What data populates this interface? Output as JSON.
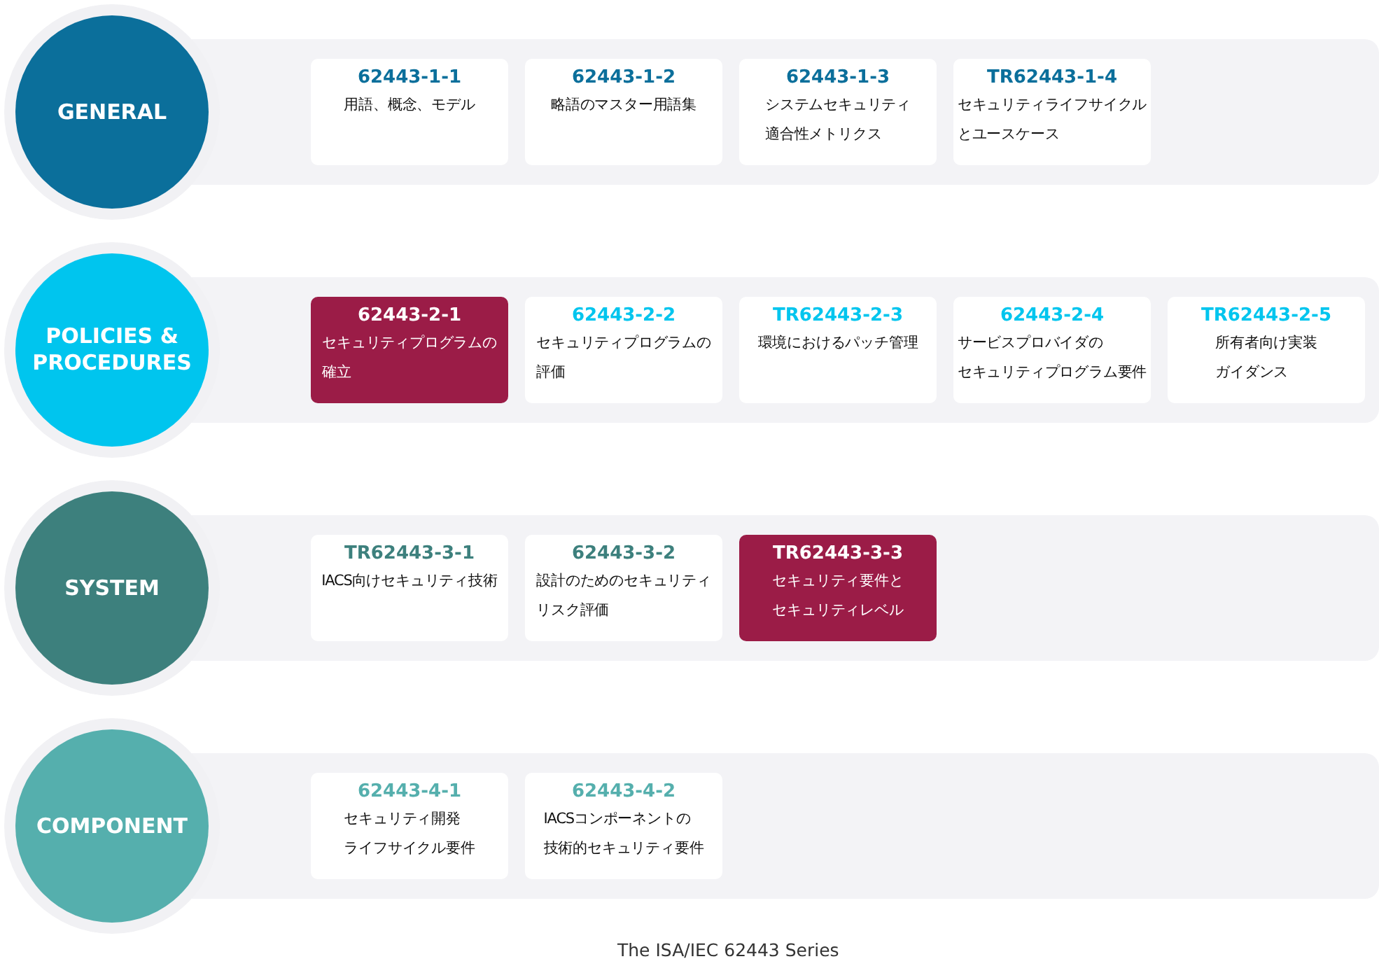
{
  "groups": [
    {
      "label": "GENERAL",
      "color": "#0b6f9b",
      "cards": [
        {
          "code": "62443-1-1",
          "lines": [
            "用語、概念、モデル"
          ],
          "selected": false
        },
        {
          "code": "62443-1-2",
          "lines": [
            "略語のマスター用語集"
          ],
          "selected": false
        },
        {
          "code": "62443-1-3",
          "lines": [
            "システムセキュリティ",
            "適合性メトリクス"
          ],
          "selected": false
        },
        {
          "code": "TR62443-1-4",
          "lines": [
            "セキュリティライフサイクル",
            "とユースケース"
          ],
          "selected": false
        }
      ]
    },
    {
      "label": "POLICIES &\nPROCEDURES",
      "color": "#00c5ee",
      "cards": [
        {
          "code": "62443-2-1",
          "lines": [
            "セキュリティプログラムの",
            "確立"
          ],
          "selected": true
        },
        {
          "code": "62443-2-2",
          "lines": [
            "セキュリティプログラムの",
            "評価"
          ],
          "selected": false
        },
        {
          "code": "TR62443-2-3",
          "lines": [
            "環境におけるパッチ管理"
          ],
          "selected": false
        },
        {
          "code": "62443-2-4",
          "lines": [
            "サービスプロバイダの",
            "セキュリティプログラム要件"
          ],
          "selected": false
        },
        {
          "code": "TR62443-2-5",
          "lines": [
            "所有者向け実装",
            "ガイダンス"
          ],
          "selected": false
        }
      ]
    },
    {
      "label": "SYSTEM",
      "color": "#3d807d",
      "cards": [
        {
          "code": "TR62443-3-1",
          "lines": [
            "IACS向けセキュリティ技術"
          ],
          "selected": false
        },
        {
          "code": "62443-3-2",
          "lines": [
            "設計のためのセキュリティ",
            "リスク評価"
          ],
          "selected": false
        },
        {
          "code": "TR62443-3-3",
          "lines": [
            "セキュリティ要件と",
            "セキュリティレベル"
          ],
          "selected": true
        }
      ]
    },
    {
      "label": "COMPONENT",
      "color": "#55afad",
      "cards": [
        {
          "code": "62443-4-1",
          "lines": [
            "セキュリティ開発",
            "ライフサイクル要件"
          ],
          "selected": false
        },
        {
          "code": "62443-4-2",
          "lines": [
            "IACSコンポーネントの",
            "技術的セキュリティ要件"
          ],
          "selected": false
        }
      ]
    }
  ],
  "caption": "The ISA/IEC 62443 Series"
}
